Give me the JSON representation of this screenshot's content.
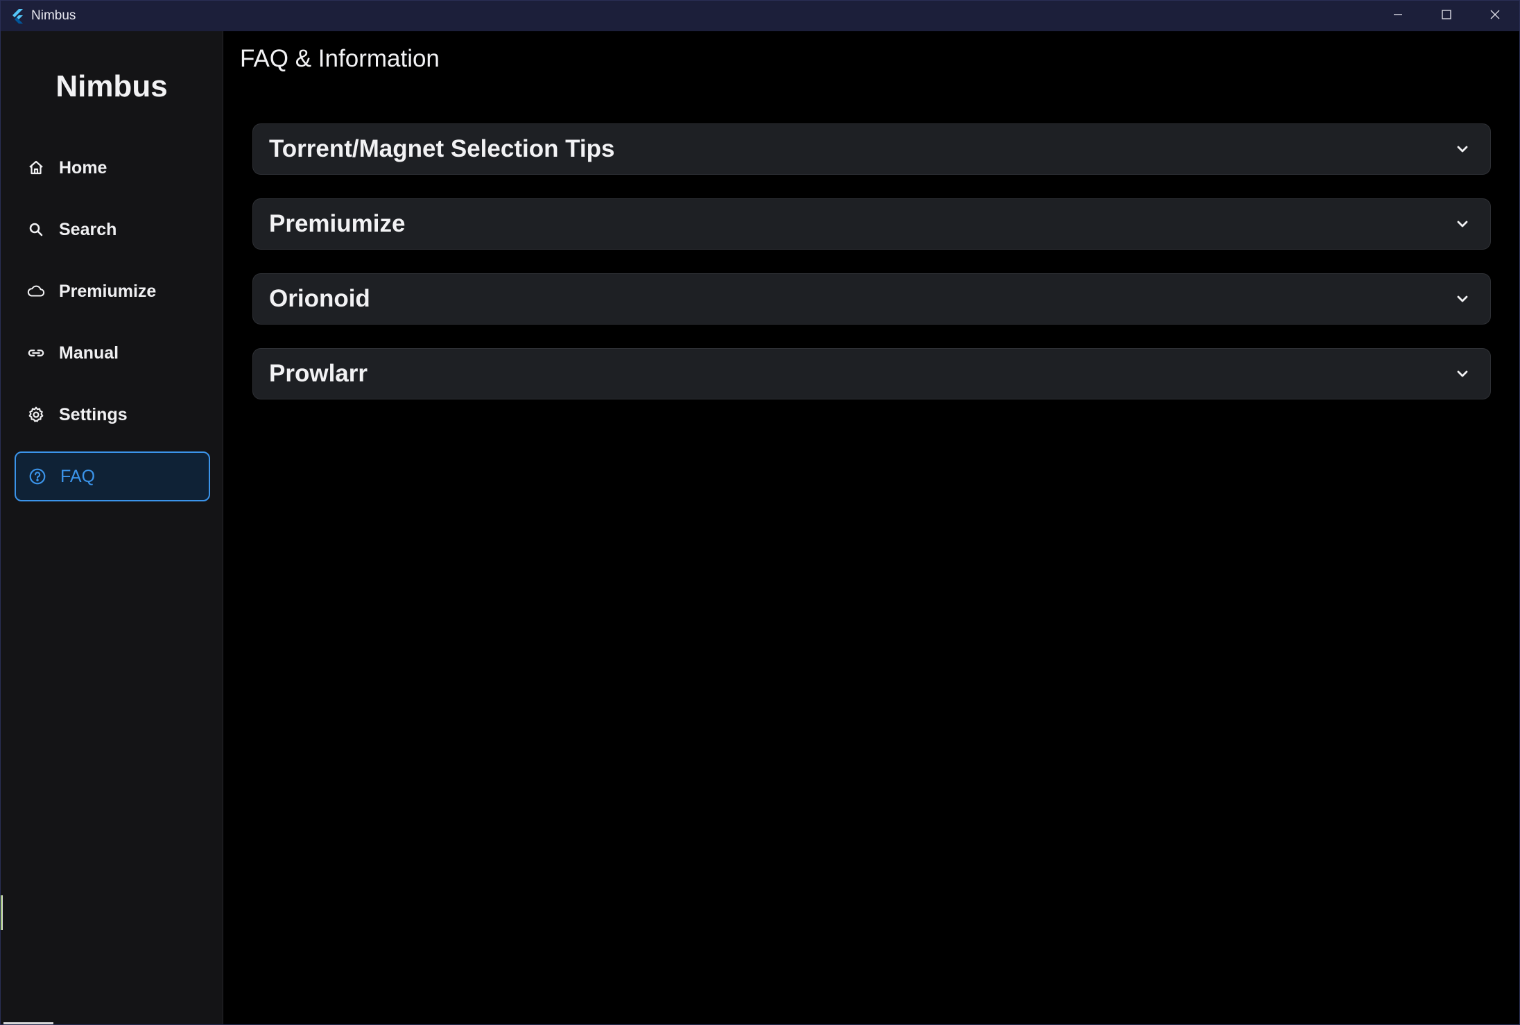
{
  "window": {
    "title": "Nimbus",
    "app_icon": "flutter-logo-icon",
    "controls": [
      "minimize-icon",
      "maximize-icon",
      "close-icon"
    ]
  },
  "sidebar": {
    "brand": "Nimbus",
    "items": [
      {
        "label": "Home",
        "icon": "home-icon",
        "active": false
      },
      {
        "label": "Search",
        "icon": "search-icon",
        "active": false
      },
      {
        "label": "Premiumize",
        "icon": "cloud-icon",
        "active": false
      },
      {
        "label": "Manual",
        "icon": "link-icon",
        "active": false
      },
      {
        "label": "Settings",
        "icon": "gear-icon",
        "active": false
      },
      {
        "label": "FAQ",
        "icon": "help-circle-icon",
        "active": true
      }
    ]
  },
  "main": {
    "title": "FAQ & Information",
    "faq": [
      {
        "title": "Torrent/Magnet Selection Tips",
        "expanded": false
      },
      {
        "title": "Premiumize",
        "expanded": false
      },
      {
        "title": "Orionoid",
        "expanded": false
      },
      {
        "title": "Prowlarr",
        "expanded": false
      }
    ]
  },
  "colors": {
    "accent": "#3b94ea",
    "background": "#000000",
    "sidebar": "#141416",
    "card": "#1e2024",
    "titlebar": "#1c1f3a"
  }
}
